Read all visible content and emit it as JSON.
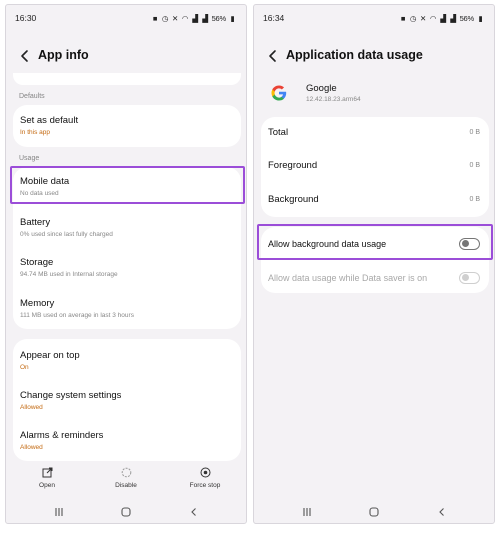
{
  "left": {
    "status": {
      "time": "16:30",
      "battery": "56%"
    },
    "header": {
      "title": "App info"
    },
    "sections": {
      "defaults": "Defaults",
      "usage": "Usage"
    },
    "set_as_default": {
      "title": "Set as default",
      "sub": "In this app"
    },
    "mobile_data": {
      "title": "Mobile data",
      "sub": "No data used"
    },
    "battery": {
      "title": "Battery",
      "sub": "0% used since last fully charged"
    },
    "storage": {
      "title": "Storage",
      "sub": "94.74 MB used in Internal storage"
    },
    "memory": {
      "title": "Memory",
      "sub": "111 MB used on average in last 3 hours"
    },
    "appear_on_top": {
      "title": "Appear on top",
      "sub": "On"
    },
    "change_system_settings": {
      "title": "Change system settings",
      "sub": "Allowed"
    },
    "alarms_reminders": {
      "title": "Alarms & reminders",
      "sub": "Allowed"
    },
    "actions": {
      "open": "Open",
      "disable": "Disable",
      "force_stop": "Force stop"
    }
  },
  "right": {
    "status": {
      "time": "16:34",
      "battery": "56%"
    },
    "header": {
      "title": "Application data usage"
    },
    "app": {
      "name": "Google",
      "version": "12.42.18.23.arm64"
    },
    "usage": {
      "total": {
        "label": "Total",
        "value": "0 B"
      },
      "foreground": {
        "label": "Foreground",
        "value": "0 B"
      },
      "background": {
        "label": "Background",
        "value": "0 B"
      }
    },
    "allow_background": {
      "label": "Allow background data usage",
      "enabled": false
    },
    "allow_data_saver": {
      "label": "Allow data usage while Data saver is on",
      "enabled": false
    }
  },
  "colors": {
    "highlight": "#9b4dd8",
    "background": "#f4f2f5",
    "accent_text": "#c46a12"
  },
  "icons": [
    "back-arrow-icon",
    "open-icon",
    "disable-icon",
    "force-stop-icon",
    "recent-apps-icon",
    "home-icon",
    "back-nav-icon",
    "google-logo-icon"
  ]
}
